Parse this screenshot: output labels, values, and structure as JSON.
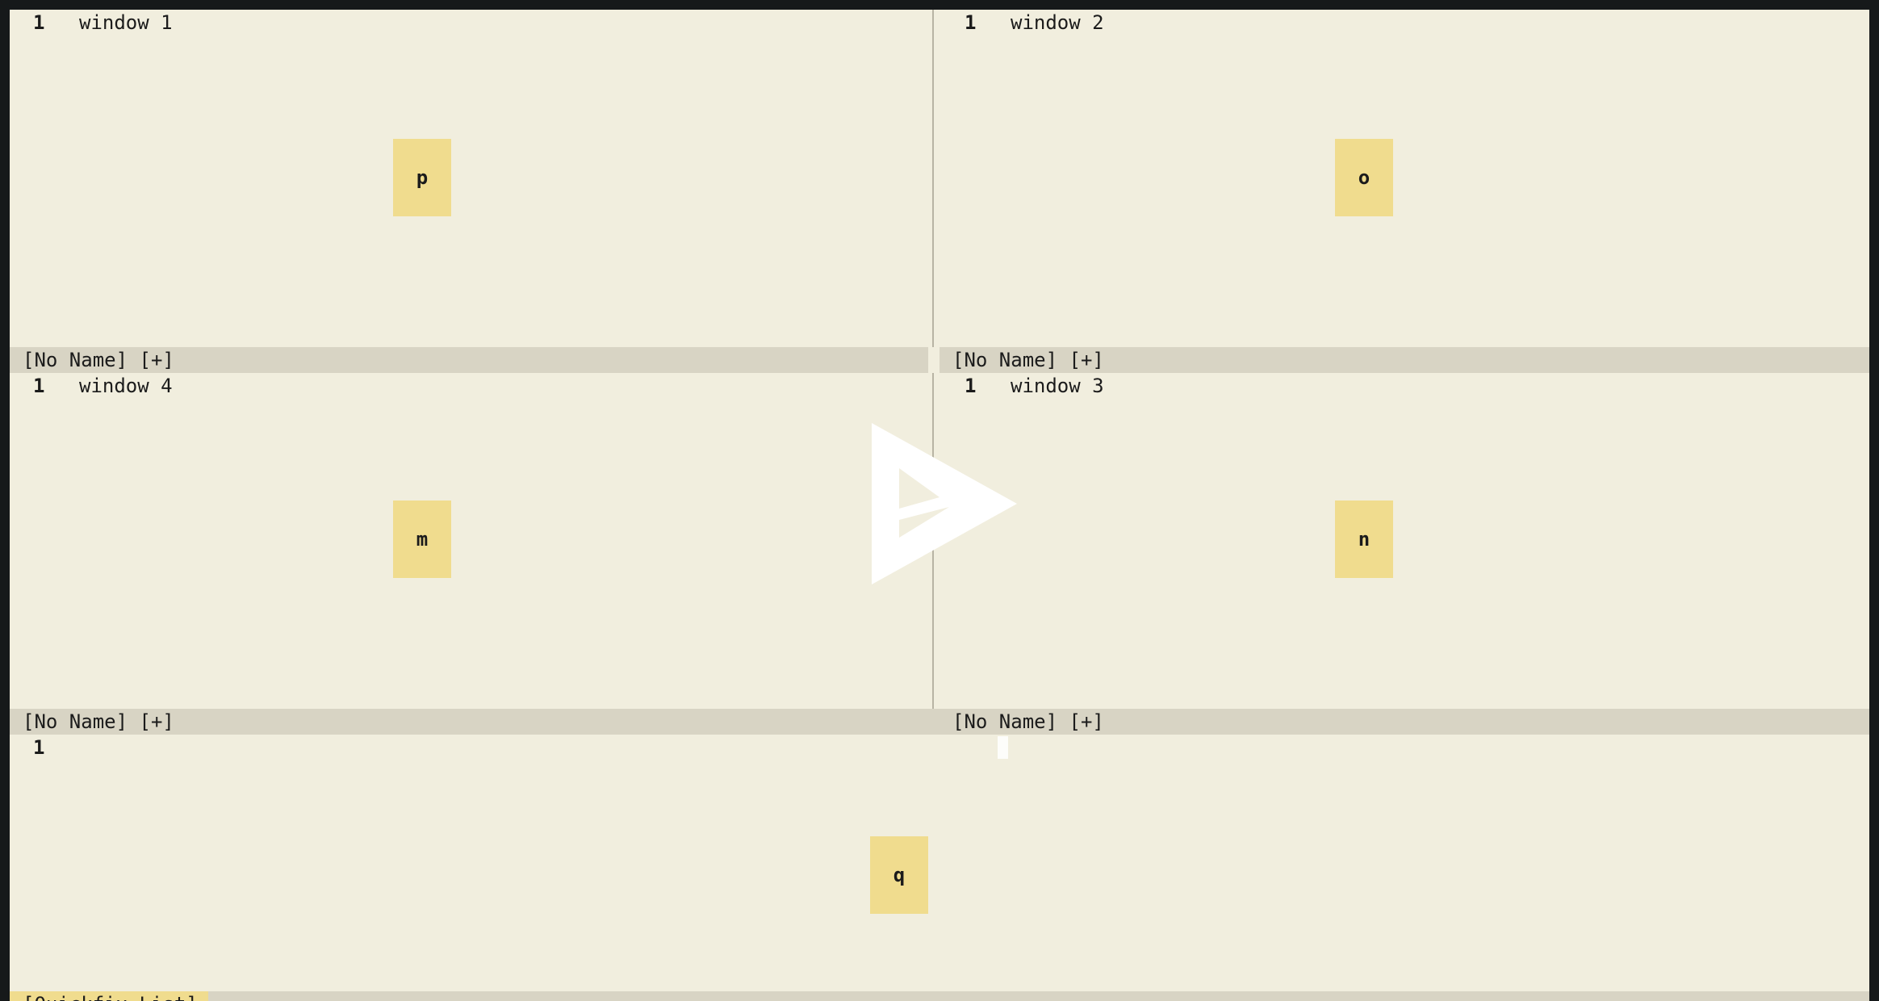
{
  "windows": {
    "top_left": {
      "line_number": "1",
      "text": "window 1",
      "status": "[No Name] [+]",
      "hint": "p"
    },
    "top_right": {
      "line_number": "1",
      "text": "window 2",
      "status": "[No Name] [+]",
      "hint": "o"
    },
    "middle_left": {
      "line_number": "1",
      "text": "window 4",
      "status": "[No Name] [+]",
      "hint": "m"
    },
    "middle_right": {
      "line_number": "1",
      "text": "window 3",
      "status": "[No Name] [+]",
      "hint": "n"
    },
    "quickfix": {
      "line_number": "1",
      "text": "",
      "status": "[Quickfix List]",
      "hint": "q"
    }
  },
  "colors": {
    "background": "#f1eede",
    "statusline": "#d8d4c4",
    "hint": "#f0dc8e",
    "frame": "#16191a"
  },
  "icons": {
    "center_logo": "play-triangle-logo-icon"
  }
}
